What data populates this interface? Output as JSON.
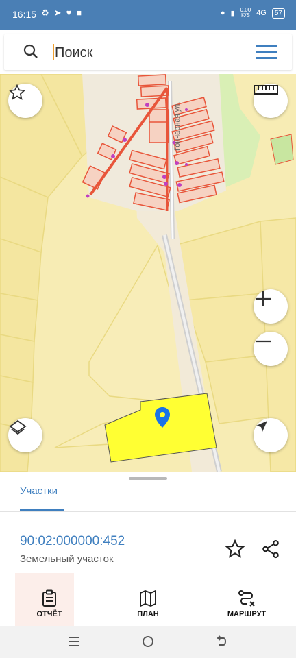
{
  "status_bar": {
    "time": "16:15",
    "net_speed_value": "0,00",
    "net_speed_unit": "K/S",
    "network": "4G",
    "battery": "57"
  },
  "search": {
    "placeholder": "Поиск"
  },
  "map": {
    "street_label": "Гончарная ул."
  },
  "sheet": {
    "tab_label": "Участки",
    "parcel_number": "90:02:000000:452",
    "parcel_type": "Земельный участок"
  },
  "actions": {
    "report_label": "ОТЧЁТ",
    "plan_label": "ПЛАН",
    "route_label": "МАРШРУТ"
  },
  "colors": {
    "status_bar": "#4a7fb5",
    "accent": "#3f7fbf",
    "map_base": "#f5e9a8",
    "selected_parcel": "#ffff33",
    "building_outline": "#e8553a",
    "marker": "#1a73e8"
  },
  "icons": [
    "search-icon",
    "menu-icon",
    "star-icon",
    "ruler-icon",
    "plus-icon",
    "minus-icon",
    "layers-icon",
    "location-arrow-icon",
    "share-icon",
    "clipboard-icon",
    "map-icon",
    "route-icon"
  ]
}
